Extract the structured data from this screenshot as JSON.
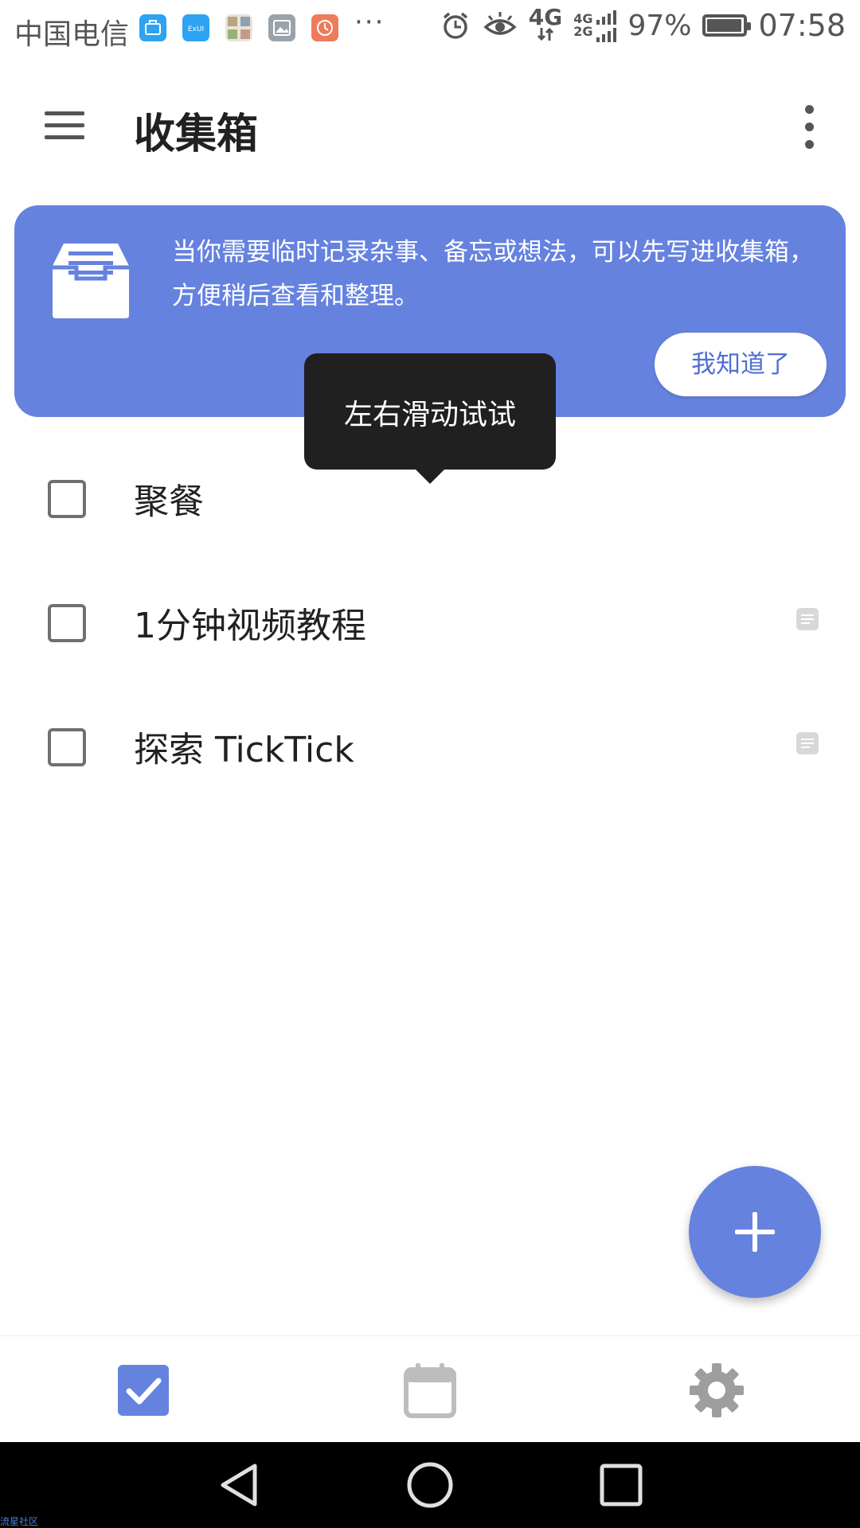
{
  "status_bar": {
    "carrier": "中国电信",
    "more": "···",
    "net_primary": "4G",
    "net_secondary": "4G\n2G",
    "battery_percent": "97%",
    "battery_level": 0.97,
    "time": "07:58",
    "notification_icons": [
      "briefcase-app-icon",
      "exui-app-icon",
      "photo-grid-app-icon",
      "gallery-app-icon",
      "clock-app-icon"
    ],
    "colors": {
      "app1": "#2ea3f2",
      "app2": "#2ea3f2",
      "app4": "#9aa3ab",
      "app5": "#ee7b5a"
    }
  },
  "app_bar": {
    "title": "收集箱",
    "menu_icon": "hamburger-menu-icon",
    "more_icon": "more-vert-icon"
  },
  "banner": {
    "icon": "inbox-tray-icon",
    "text": "当你需要临时记录杂事、备忘或想法，可以先写进收集箱，方便稍后查看和整理。",
    "button_label": "我知道了",
    "color": "#6582df"
  },
  "tooltip": {
    "text": "左右滑动试试"
  },
  "tasks": [
    {
      "title": "聚餐",
      "has_note": false,
      "checked": false
    },
    {
      "title": "1分钟视频教程",
      "has_note": true,
      "checked": false
    },
    {
      "title": "探索 TickTick",
      "has_note": true,
      "checked": false
    }
  ],
  "fab": {
    "icon": "add-icon",
    "color": "#6582df"
  },
  "bottom_nav": [
    {
      "name": "tasks",
      "icon": "checkbox-checked-icon",
      "active": true
    },
    {
      "name": "calendar",
      "icon": "calendar-icon",
      "active": false
    },
    {
      "name": "settings",
      "icon": "gear-icon",
      "active": false
    }
  ],
  "system_nav": [
    "back-icon",
    "home-icon",
    "recents-icon"
  ],
  "watermark": "流星社区"
}
